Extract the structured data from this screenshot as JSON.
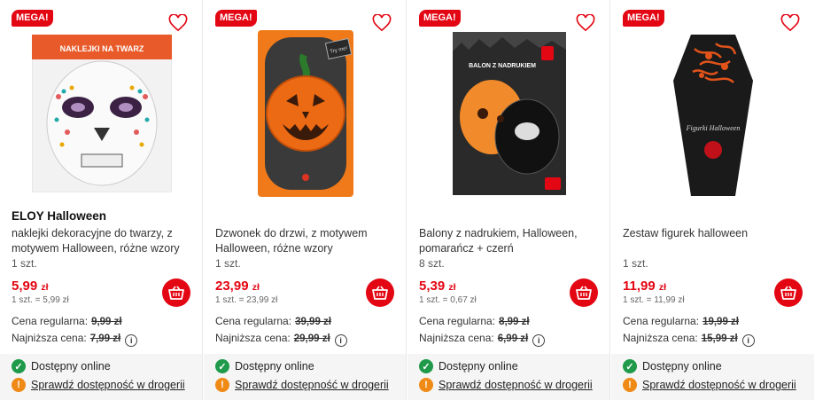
{
  "products": [
    {
      "badge": "MEGA!",
      "brand": "ELOY Halloween",
      "name": "naklejki dekoracyjne do twarzy, z motywem Halloween, różne wzory",
      "qty": "1 szt.",
      "price_main": "5,99",
      "price_currency": "zł",
      "unit_price": "1 szt. = 5,99 zł",
      "regular_label": "Cena regularna:",
      "regular_value": "9,99 zł",
      "lowest_label": "Najniższa cena:",
      "lowest_value": "7,99 zł",
      "available_label": "Dostępny online",
      "check_store_label": "Sprawdź dostępność w drogerii",
      "image_text": "NAKLEJKI NA TWARZ"
    },
    {
      "badge": "MEGA!",
      "brand": "",
      "name": "Dzwonek do drzwi, z motywem Halloween, różne wzory",
      "qty": "1 szt.",
      "price_main": "23,99",
      "price_currency": "zł",
      "unit_price": "1 szt. = 23,99 zł",
      "regular_label": "Cena regularna:",
      "regular_value": "39,99 zł",
      "lowest_label": "Najniższa cena:",
      "lowest_value": "29,99 zł",
      "available_label": "Dostępny online",
      "check_store_label": "Sprawdź dostępność w drogerii",
      "image_text": "Try me!"
    },
    {
      "badge": "MEGA!",
      "brand": "",
      "name": "Balony z nadrukiem, Halloween, pomarańcz + czerń",
      "qty": "8 szt.",
      "price_main": "5,39",
      "price_currency": "zł",
      "unit_price": "1 szt. = 0,67 zł",
      "regular_label": "Cena regularna:",
      "regular_value": "8,99 zł",
      "lowest_label": "Najniższa cena:",
      "lowest_value": "6,99 zł",
      "available_label": "Dostępny online",
      "check_store_label": "Sprawdź dostępność w drogerii",
      "image_text": "BALON Z NADRUKIEM"
    },
    {
      "badge": "MEGA!",
      "brand": "",
      "name": "Zestaw figurek halloween",
      "qty": "1 szt.",
      "price_main": "11,99",
      "price_currency": "zł",
      "unit_price": "1 szt. = 11,99 zł",
      "regular_label": "Cena regularna:",
      "regular_value": "19,99 zł",
      "lowest_label": "Najniższa cena:",
      "lowest_value": "15,99 zł",
      "available_label": "Dostępny online",
      "check_store_label": "Sprawdź dostępność w drogerii",
      "image_text": "Figurki Halloween"
    }
  ],
  "icons": {
    "favorite": "heart-outline-icon",
    "cart": "basket-icon",
    "info": "info-circle-icon",
    "available": "check-circle-icon",
    "store": "exclamation-circle-icon"
  },
  "colors": {
    "accent": "#e30613",
    "available": "#1f9a4a",
    "warning": "#f08a16"
  }
}
